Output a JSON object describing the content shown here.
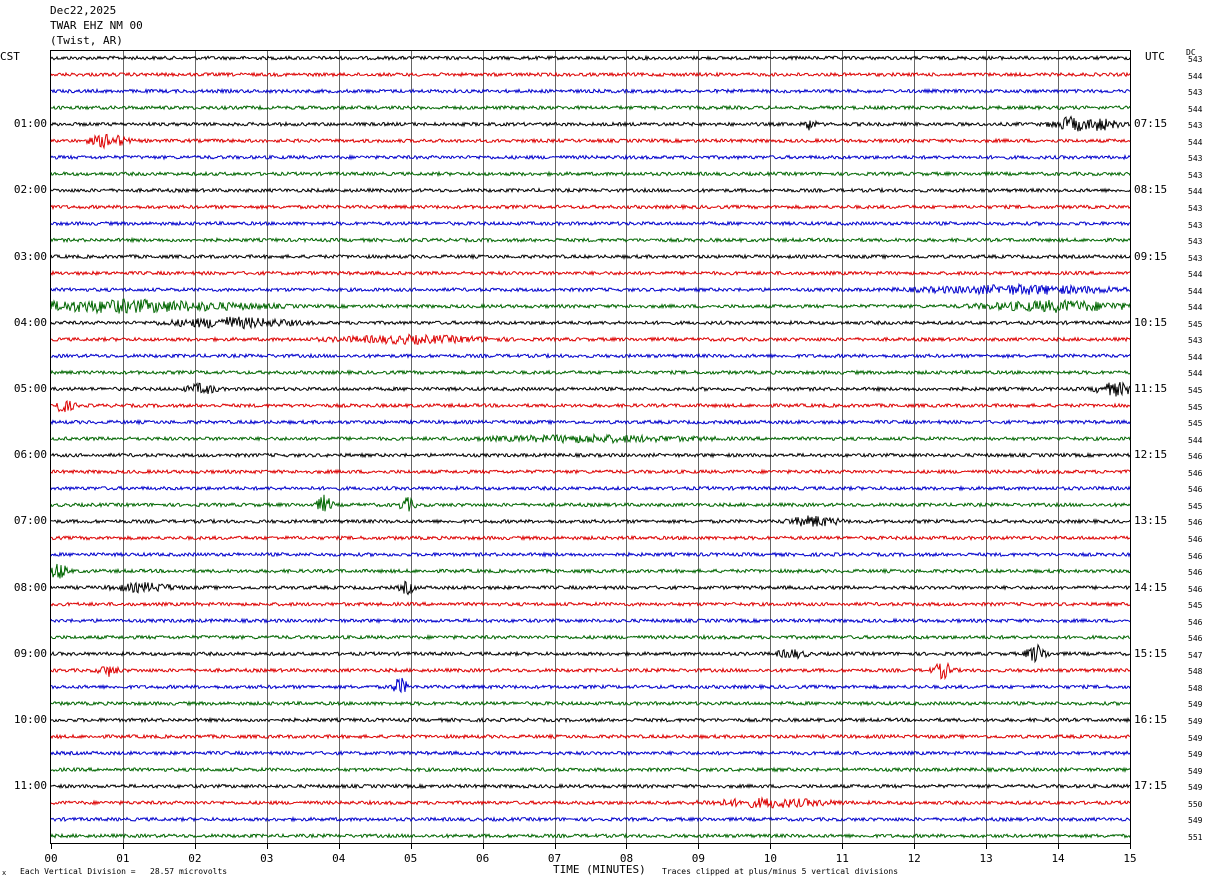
{
  "header": {
    "date": "Dec22,2025",
    "station": "TWAR EHZ NM 00",
    "location": "(Twist, AR)"
  },
  "left_timezone": "CST",
  "right_timezone": "UTC",
  "dc_header": "DC",
  "footer": {
    "mark": "x",
    "vertical_division": "Each Vertical Division =   28.57 microvolts",
    "clipping": "Traces clipped at plus/minus 5 vertical divisions"
  },
  "chart_data": {
    "type": "line",
    "xlabel": "TIME (MINUTES)",
    "xlim": [
      0,
      15
    ],
    "x_ticks": [
      "00",
      "01",
      "02",
      "03",
      "04",
      "05",
      "06",
      "07",
      "08",
      "09",
      "10",
      "11",
      "12",
      "13",
      "14",
      "15"
    ],
    "trace_count": 48,
    "trace_minutes": 15,
    "trace_colors": [
      "#000000",
      "#dd0000",
      "#0000cc",
      "#006600"
    ],
    "grid": true,
    "left_hour_labels": [
      "01:00",
      "02:00",
      "03:00",
      "04:00",
      "05:00",
      "06:00",
      "07:00",
      "08:00",
      "09:00",
      "10:00",
      "11:00"
    ],
    "right_hour_labels": [
      "07:15",
      "08:15",
      "09:15",
      "10:15",
      "11:15",
      "12:15",
      "13:15",
      "14:15",
      "15:15",
      "16:15",
      "17:15"
    ],
    "hour_label_trace_index": [
      4,
      8,
      12,
      16,
      20,
      24,
      28,
      32,
      36,
      40,
      44
    ],
    "dc_offsets": [
      543,
      544,
      543,
      544,
      543,
      544,
      543,
      543,
      544,
      543,
      543,
      543,
      543,
      544,
      544,
      544,
      545,
      543,
      544,
      544,
      545,
      545,
      545,
      544,
      546,
      546,
      546,
      545,
      546,
      546,
      546,
      546,
      546,
      545,
      546,
      546,
      547,
      548,
      548,
      549,
      549,
      549,
      549,
      549,
      549,
      550,
      549,
      551
    ],
    "events": [
      {
        "trace": 4,
        "minute": 10.55,
        "amp": 6,
        "width": 0.12
      },
      {
        "trace": 4,
        "minute": 14.2,
        "amp": 7,
        "width": 0.4
      },
      {
        "trace": 4,
        "minute": 14.55,
        "amp": 6,
        "width": 0.4
      },
      {
        "trace": 5,
        "minute": 0.8,
        "amp": 7,
        "width": 0.35
      },
      {
        "trace": 14,
        "minute": 13.5,
        "amp": 4,
        "width": 2.0
      },
      {
        "trace": 15,
        "minute": 1.0,
        "amp": 6,
        "width": 2.5
      },
      {
        "trace": 15,
        "minute": 14.0,
        "amp": 5,
        "width": 1.5
      },
      {
        "trace": 16,
        "minute": 2.5,
        "amp": 5,
        "width": 1.2
      },
      {
        "trace": 17,
        "minute": 5.0,
        "amp": 3.5,
        "width": 1.5
      },
      {
        "trace": 20,
        "minute": 2.1,
        "amp": 5,
        "width": 0.3
      },
      {
        "trace": 20,
        "minute": 14.8,
        "amp": 6,
        "width": 0.4
      },
      {
        "trace": 21,
        "minute": 0.15,
        "amp": 6,
        "width": 0.25
      },
      {
        "trace": 23,
        "minute": 7.5,
        "amp": 3,
        "width": 2.0
      },
      {
        "trace": 27,
        "minute": 3.8,
        "amp": 9,
        "width": 0.15
      },
      {
        "trace": 27,
        "minute": 4.95,
        "amp": 7,
        "width": 0.15
      },
      {
        "trace": 28,
        "minute": 10.6,
        "amp": 5,
        "width": 0.5
      },
      {
        "trace": 31,
        "minute": 0.1,
        "amp": 8,
        "width": 0.2
      },
      {
        "trace": 32,
        "minute": 1.3,
        "amp": 4,
        "width": 0.6
      },
      {
        "trace": 32,
        "minute": 4.95,
        "amp": 6,
        "width": 0.15
      },
      {
        "trace": 36,
        "minute": 13.7,
        "amp": 9,
        "width": 0.2
      },
      {
        "trace": 36,
        "minute": 10.3,
        "amp": 4,
        "width": 0.3
      },
      {
        "trace": 37,
        "minute": 12.4,
        "amp": 8,
        "width": 0.2
      },
      {
        "trace": 37,
        "minute": 0.8,
        "amp": 5,
        "width": 0.2
      },
      {
        "trace": 38,
        "minute": 4.85,
        "amp": 9,
        "width": 0.15
      },
      {
        "trace": 45,
        "minute": 10.0,
        "amp": 4,
        "width": 1.2
      }
    ]
  }
}
